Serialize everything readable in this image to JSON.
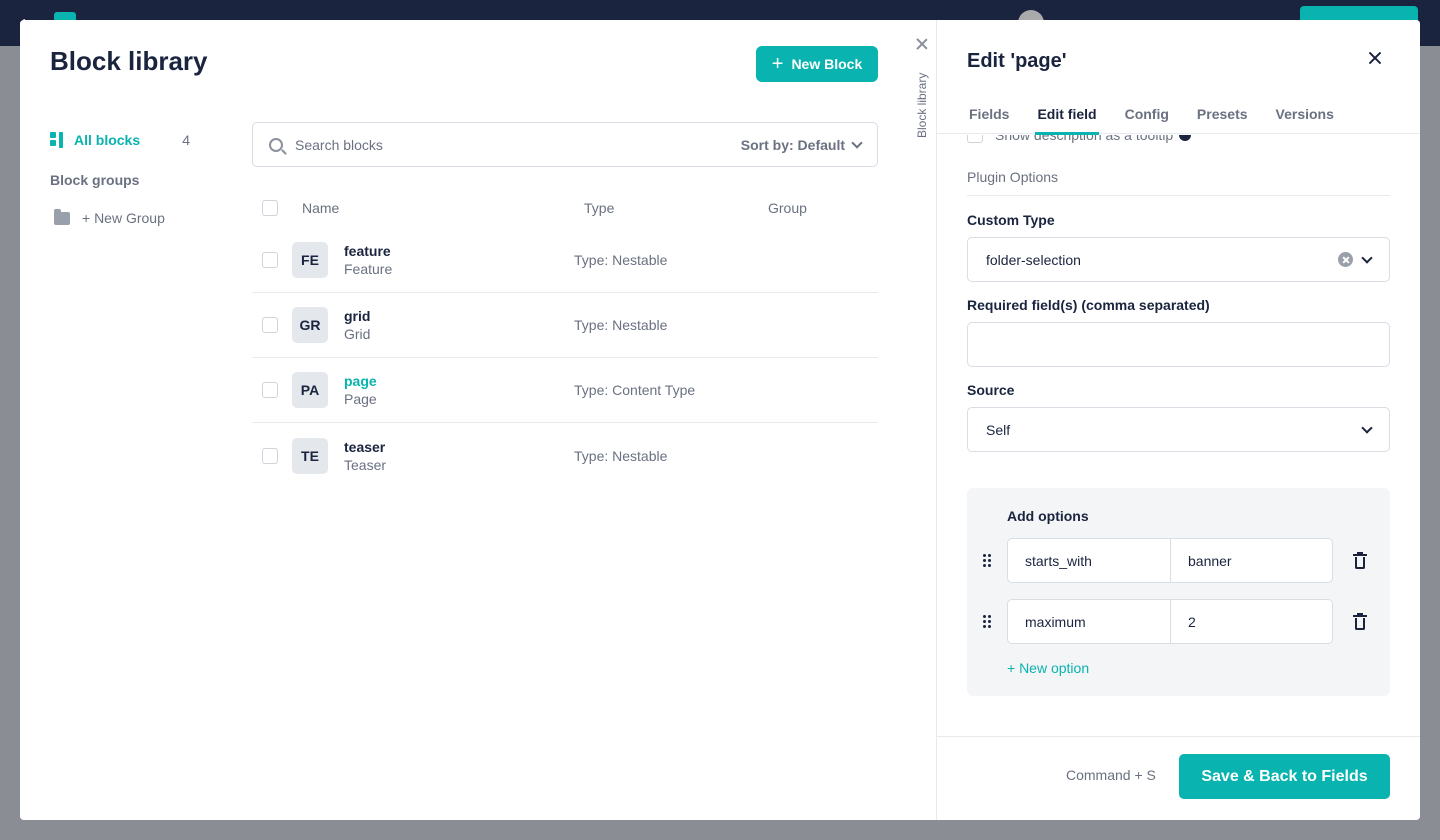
{
  "colors": {
    "accent": "#09b3af",
    "text": "#1b243f",
    "muted": "#6a7180"
  },
  "library": {
    "title": "Block library",
    "new_block_label": "New Block",
    "vertical_label": "Block library",
    "nav": {
      "all_blocks_label": "All blocks",
      "all_blocks_count": "4",
      "block_groups_label": "Block groups",
      "new_group_label": "+ New Group"
    },
    "search": {
      "placeholder": "Search blocks",
      "value": ""
    },
    "sort_label": "Sort by: Default",
    "columns": {
      "name": "Name",
      "type": "Type",
      "group": "Group"
    },
    "rows": [
      {
        "initials": "FE",
        "tech_name": "feature",
        "display_name": "Feature",
        "type": "Type: Nestable",
        "group": ""
      },
      {
        "initials": "GR",
        "tech_name": "grid",
        "display_name": "Grid",
        "type": "Type: Nestable",
        "group": ""
      },
      {
        "initials": "PA",
        "tech_name": "page",
        "display_name": "Page",
        "type": "Type: Content Type",
        "group": ""
      },
      {
        "initials": "TE",
        "tech_name": "teaser",
        "display_name": "Teaser",
        "type": "Type: Nestable",
        "group": ""
      }
    ]
  },
  "edit": {
    "title": "Edit 'page'",
    "tabs": [
      {
        "label": "Fields"
      },
      {
        "label": "Edit field"
      },
      {
        "label": "Config"
      },
      {
        "label": "Presets"
      },
      {
        "label": "Versions"
      }
    ],
    "cut_off_text": "Show description as a tooltip",
    "plugin_options_heading": "Plugin Options",
    "custom_type": {
      "label": "Custom Type",
      "value": "folder-selection"
    },
    "required_fields": {
      "label": "Required field(s) (comma separated)",
      "value": ""
    },
    "source": {
      "label": "Source",
      "value": "Self"
    },
    "options": {
      "title": "Add options",
      "items": [
        {
          "key": "starts_with",
          "value": "banner"
        },
        {
          "key": "maximum",
          "value": "2"
        }
      ],
      "new_option_label": "+ New option"
    },
    "footer": {
      "shortcut": "Command + S",
      "save_label": "Save & Back to Fields"
    }
  }
}
